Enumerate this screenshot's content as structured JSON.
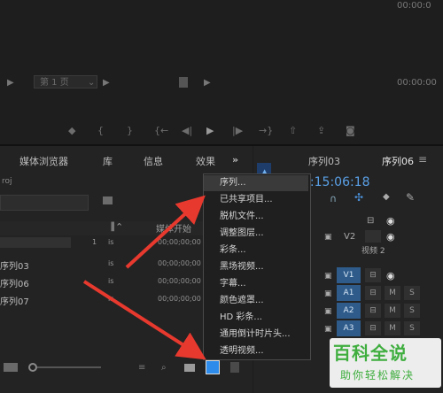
{
  "monitor": {
    "page_select": "第 1 页",
    "timecode_right_top": "00:00:0",
    "timecode_right": "00:00:00",
    "transport_icons": [
      "marker-icon",
      "in-point-icon",
      "out-point-icon",
      "go-to-in-icon",
      "step-back-icon",
      "play-icon",
      "step-forward-icon",
      "go-to-out-icon",
      "lift-icon",
      "extract-icon",
      "export-frame-icon"
    ]
  },
  "project": {
    "tabs": [
      "媒体浏览器",
      "库",
      "信息",
      "效果"
    ],
    "more": "»",
    "label": "roj",
    "column_start": "媒体开始",
    "rows": [
      {
        "name": "",
        "frames": "1",
        "flag": "is",
        "start": "00;00;00;00"
      },
      {
        "name": "序列03",
        "frames": "",
        "flag": "is",
        "start": "00;00;00;00"
      },
      {
        "name": "序列06",
        "frames": "",
        "flag": "is",
        "start": "00;00;00;00"
      },
      {
        "name": "序列07",
        "frames": "",
        "flag": "is",
        "start": "00;00;00;00"
      }
    ]
  },
  "timeline": {
    "tabs": [
      "序列03",
      "序列06"
    ],
    "timecode": "0:15:06:18",
    "v2_label": "V2",
    "video2_label": "视频 2",
    "tracks": [
      "V1",
      "A1",
      "A2",
      "A3"
    ],
    "toggles": [
      "M",
      "S"
    ]
  },
  "menu": {
    "items": [
      "序列...",
      "已共享项目...",
      "脱机文件...",
      "调整图层...",
      "彩条...",
      "黑场视频...",
      "字幕...",
      "颜色遮罩...",
      "HD 彩条...",
      "通用倒计时片头...",
      "透明视频..."
    ]
  },
  "watermark": {
    "title": "百科全说",
    "subtitle": "助你轻松解决"
  },
  "colors": {
    "accent": "#2d8ceb",
    "track_blue": "#2e5b8a",
    "arrow_red": "#e8392e",
    "watermark_green": "#3fae3f"
  }
}
